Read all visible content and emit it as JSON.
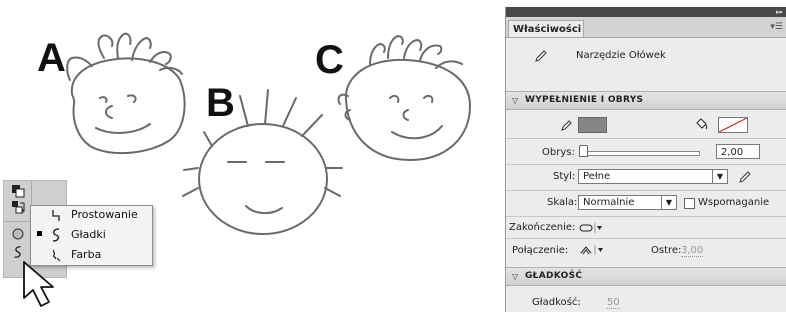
{
  "canvas": {
    "letters": [
      "A",
      "B",
      "C"
    ]
  },
  "toolbox": {
    "icons": [
      "fill-stroke-swap-icon",
      "swap-colors-icon",
      "object-drawing-icon",
      "pencil-mode-icon"
    ]
  },
  "pencil_mode_menu": {
    "items": [
      {
        "label": "Prostowanie",
        "icon": "straighten-icon",
        "selected": false
      },
      {
        "label": "Gładki",
        "icon": "smooth-icon",
        "selected": true
      },
      {
        "label": "Farba",
        "icon": "ink-icon",
        "selected": false
      }
    ]
  },
  "properties_panel": {
    "tab_label": "Właściwości",
    "tool_name": "Narzędzie Ołówek",
    "fill_stroke": {
      "section_title": "WYPEŁNIENIE I OBRYS",
      "stroke_color": "#858585",
      "obrys_label": "Obrys:",
      "obrys_value": "2,00",
      "styl_label": "Styl:",
      "styl_value": "Pełne",
      "skala_label": "Skala:",
      "skala_value": "Normalnie",
      "wspomaganie_label": "Wspomaganie",
      "zakonczenie_label": "Zakończenie:",
      "polaczenie_label": "Połączenie:",
      "ostre_label": "Ostre:",
      "ostre_value": "3,00"
    },
    "smoothing": {
      "section_title": "GŁADKOŚĆ",
      "gladkosc_label": "Gładkość:",
      "gladkosc_value": "50"
    }
  }
}
